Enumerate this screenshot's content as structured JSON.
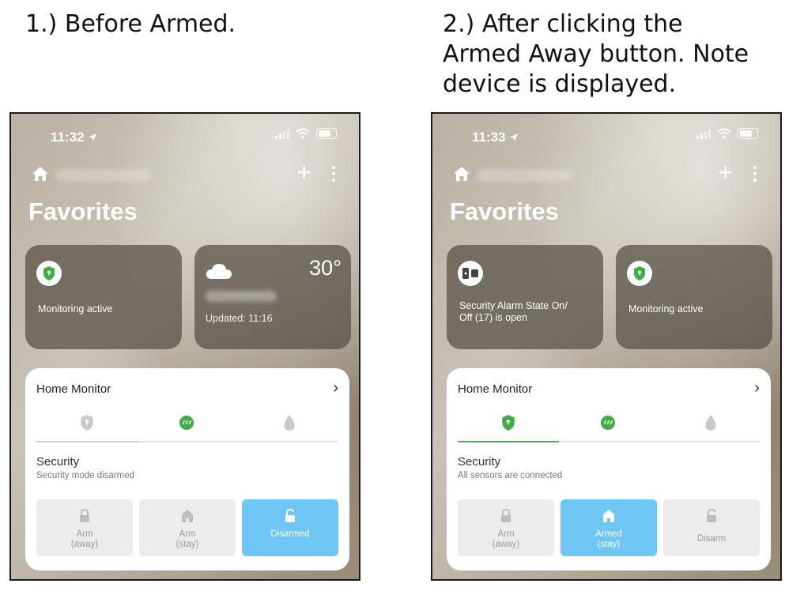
{
  "captions": {
    "left": "1.) Before Armed.",
    "right_line1": "2.) After clicking the",
    "right_line2": "Armed Away button. Note",
    "right_line3": "device is displayed."
  },
  "colors": {
    "accent_green": "#4caf50",
    "active_blue": "#6ec6f5"
  },
  "screens": [
    {
      "time": "11:32",
      "title": "Favorites",
      "tile_left": {
        "icon": "shield-icon",
        "text": "Monitoring active"
      },
      "tile_right": {
        "icon": "cloud-icon",
        "temperature": "30°",
        "updated": "Updated: 11:16"
      },
      "card": {
        "title": "Home Monitor",
        "chevron": "›",
        "section_title": "Security",
        "section_sub": "Security mode disarmed",
        "buttons": [
          {
            "label": "Arm\n(away)",
            "icon": "lock-icon",
            "active": false
          },
          {
            "label": "Arm\n(stay)",
            "icon": "home-icon",
            "active": false
          },
          {
            "label": "Disarmed",
            "icon": "unlock-icon",
            "active": true
          }
        ]
      }
    },
    {
      "time": "11:33",
      "title": "Favorites",
      "tile_left": {
        "icon": "door-sensor-icon",
        "text": "Security Alarm State On/\nOff (17) is open"
      },
      "tile_right": {
        "icon": "shield-icon",
        "text": "Monitoring active"
      },
      "card": {
        "title": "Home Monitor",
        "chevron": "›",
        "section_title": "Security",
        "section_sub": "All sensors are connected",
        "buttons": [
          {
            "label": "Arm\n(away)",
            "icon": "lock-icon",
            "active": false
          },
          {
            "label": "Armed\n(stay)",
            "icon": "home-icon",
            "active": true
          },
          {
            "label": "Disarm",
            "icon": "unlock-icon",
            "active": false
          }
        ]
      }
    }
  ]
}
